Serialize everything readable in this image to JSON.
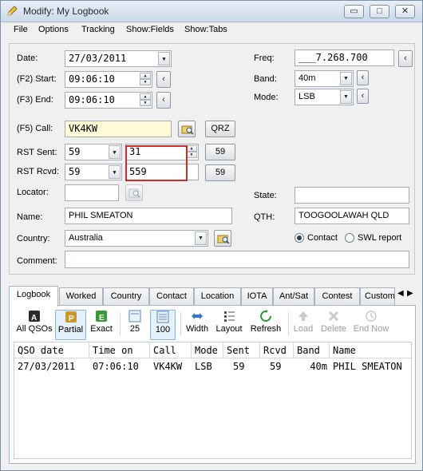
{
  "window": {
    "title": "Modify: My Logbook"
  },
  "menu": [
    "File",
    "Options",
    "Tracking",
    "Show:Fields",
    "Show:Tabs"
  ],
  "caption_buttons": {
    "minimize": "▭",
    "maximize": "□",
    "close": "✕"
  },
  "form": {
    "date_label": "Date:",
    "date_value": "27/03/2011",
    "start_label": "(F2) Start:",
    "start_value": "09:06:10",
    "end_label": "(F3) End:",
    "end_value": "09:06:10",
    "call_label": "(F5) Call:",
    "call_value": "VK4KW",
    "qrz_label": "QRZ",
    "rst_sent_label": "RST Sent:",
    "rst_sent_value": "59",
    "rst_sent_extra": "31",
    "rst_sent_button": "59",
    "rst_rcvd_label": "RST Rcvd:",
    "rst_rcvd_value": "59",
    "rst_rcvd_extra": "559",
    "rst_rcvd_button": "59",
    "locator_label": "Locator:",
    "locator_value": "",
    "name_label": "Name:",
    "name_value": "PHIL SMEATON",
    "country_label": "Country:",
    "country_value": "Australia",
    "comment_label": "Comment:",
    "comment_value": "",
    "freq_label": "Freq:",
    "freq_value": "___7.268.700",
    "band_label": "Band:",
    "band_value": "40m",
    "mode_label": "Mode:",
    "mode_value": "LSB",
    "state_label": "State:",
    "state_value": "",
    "qth_label": "QTH:",
    "qth_value": "TOOGOOLAWAH QLD",
    "radio_contact_label": "Contact",
    "radio_swl_label": "SWL report",
    "back_arrow": "‹"
  },
  "tabs": [
    "Logbook",
    "Worked",
    "Country",
    "Contact",
    "Location",
    "IOTA",
    "Ant/Sat",
    "Contest",
    "Custom"
  ],
  "toolbar": {
    "all_qsos": "All QSOs",
    "partial": "Partial",
    "exact": "Exact",
    "n25": "25",
    "n100": "100",
    "width": "Width",
    "layout": "Layout",
    "refresh": "Refresh",
    "load": "Load",
    "delete": "Delete",
    "end_now": "End Now",
    "icon_all": "A",
    "icon_partial": "P",
    "icon_exact": "E"
  },
  "grid": {
    "headers": [
      "QSO date",
      "Time on",
      "Call",
      "Mode",
      "Sent",
      "Rcvd",
      "Band",
      "Name"
    ],
    "rows": [
      [
        "27/03/2011",
        "07:06:10",
        "VK4KW",
        "LSB",
        "59",
        "59",
        "40m",
        "PHIL SMEATON"
      ]
    ]
  },
  "colors": {
    "highlight": "#d12a2a",
    "call_bg": "#fffbd6",
    "accent": "#3478c6"
  }
}
